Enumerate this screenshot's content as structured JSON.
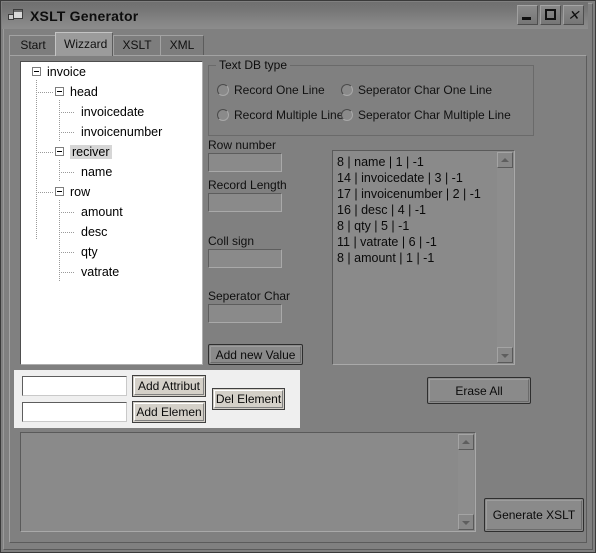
{
  "window": {
    "title": "XSLT Generator",
    "icon": "app-form-icon",
    "buttons": {
      "minimize": "minimize-icon",
      "maximize": "maximize-icon",
      "close": "close-icon"
    }
  },
  "tabs": [
    {
      "label": "Start",
      "active": false
    },
    {
      "label": "Wizzard",
      "active": true
    },
    {
      "label": "XSLT",
      "active": false
    },
    {
      "label": "XML",
      "active": false
    }
  ],
  "tree": {
    "nodes": [
      {
        "label": "invoice",
        "depth": 0,
        "expander": true,
        "selected": false
      },
      {
        "label": "head",
        "depth": 1,
        "expander": true,
        "selected": false
      },
      {
        "label": "invoicedate",
        "depth": 2,
        "expander": false,
        "selected": false
      },
      {
        "label": "invoicenumber",
        "depth": 2,
        "expander": false,
        "selected": false
      },
      {
        "label": "reciver",
        "depth": 1,
        "expander": true,
        "selected": true
      },
      {
        "label": "name",
        "depth": 2,
        "expander": false,
        "selected": false
      },
      {
        "label": "row",
        "depth": 1,
        "expander": true,
        "selected": false
      },
      {
        "label": "amount",
        "depth": 2,
        "expander": false,
        "selected": false
      },
      {
        "label": "desc",
        "depth": 2,
        "expander": false,
        "selected": false
      },
      {
        "label": "qty",
        "depth": 2,
        "expander": false,
        "selected": false
      },
      {
        "label": "vatrate",
        "depth": 2,
        "expander": false,
        "selected": false
      }
    ]
  },
  "dbtype": {
    "title": "Text DB type",
    "options": [
      {
        "label": "Record One Line",
        "checked": false
      },
      {
        "label": "Seperator Char One Line",
        "checked": false
      },
      {
        "label": "Record Multiple Line",
        "checked": false
      },
      {
        "label": "Seperator Char Multiple Line",
        "checked": false
      }
    ]
  },
  "form": {
    "row_number_label": "Row number",
    "row_number_value": "",
    "record_length_label": "Record Length",
    "record_length_value": "",
    "coll_sign_label": "Coll sign",
    "coll_sign_value": "",
    "seperator_char_label": "Seperator Char",
    "seperator_char_value": "",
    "add_new_value_label": "Add new Value"
  },
  "value_list": {
    "items": [
      "8 | name | 1 | -1",
      "14 | invoicedate | 3 | -1",
      "17 | invoicenumber | 2 | -1",
      "16 | desc | 4 | -1",
      "8 | qty | 5 | -1",
      "11 | vatrate | 6 | -1",
      "8 | amount | 1 | -1"
    ]
  },
  "element_panel": {
    "attribute_value": "",
    "attribute_placeholder": "",
    "element_value": "",
    "element_placeholder": "",
    "add_attribute_label": "Add Attribut",
    "add_element_label": "Add Elemen",
    "del_element_label": "Del Element"
  },
  "actions": {
    "erase_all_label": "Erase All",
    "generate_label": "Generate XSLT"
  },
  "output": {
    "value": "",
    "placeholder": ""
  }
}
